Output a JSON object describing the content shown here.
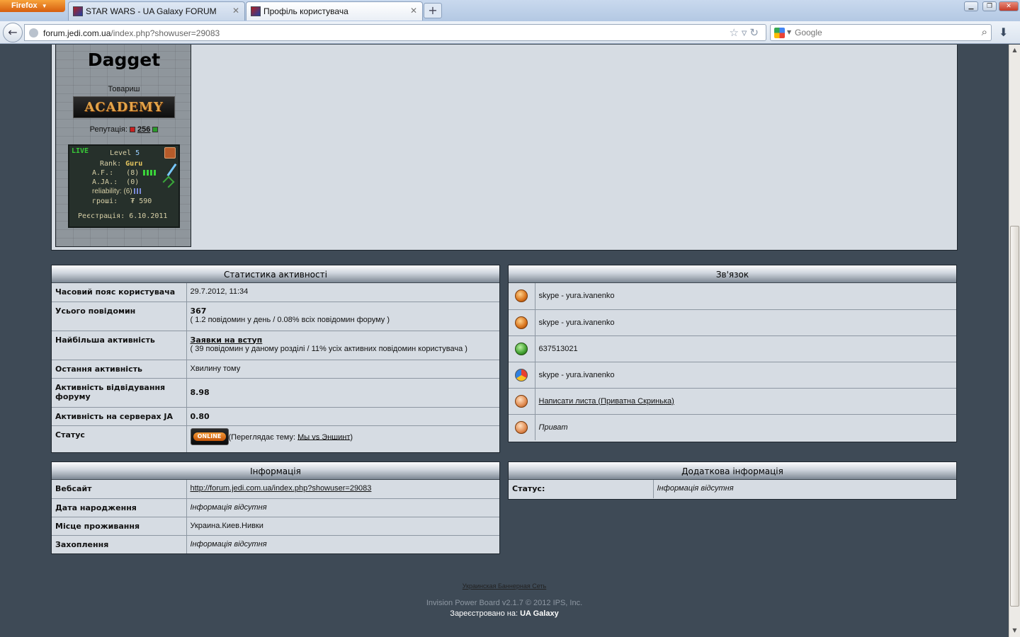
{
  "browser": {
    "app_button": "Firefox",
    "tabs": [
      {
        "label": "STAR WARS - UA Galaxy FORUM"
      },
      {
        "label": "Профіль користувача"
      }
    ],
    "url_domain": "forum.jedi.com.ua",
    "url_path": "/index.php?showuser=29083",
    "search_placeholder": "Google"
  },
  "profile": {
    "name": "Dagget",
    "title": "Товариш",
    "group_badge": "ACADEMY",
    "reputation_label": "Репутація:",
    "reputation_value": "256",
    "stats": {
      "live": "LIVE",
      "level_label": "Level",
      "level_value": "5",
      "rank_label": "Rank:",
      "rank_value": "Guru",
      "af_label": "A.F.:",
      "af_value": "(8)",
      "aja_label": "A.JA.:",
      "aja_value": "(0)",
      "reliability_label": "reliability:",
      "reliability_value": "(6)",
      "money_label": "гроші:",
      "money_value": "590",
      "registration": "Реєстрація: 6.10.2011"
    }
  },
  "activity": {
    "title": "Статистика активності",
    "timezone_label": "Часовий пояс користувача",
    "timezone_value": "29.7.2012, 11:34",
    "posts_label": "Усього повідомин",
    "posts_value": "367",
    "posts_detail": "( 1.2 повідомин у день / 0.08% всіх повідомин форуму )",
    "most_active_label": "Найбільша активність",
    "most_active_forum": "Заявки на вступ",
    "most_active_detail": "( 39 повідомин у даному розділі / 11% усіх активних повідомин користувача )",
    "last_active_label": "Остання активність",
    "last_active_value": "Хвилину тому",
    "visit_label": "Активність відвідування форуму",
    "visit_value": "8.98",
    "ja_label": "Активність на серверах JA",
    "ja_value": "0.80",
    "status_label": "Статус",
    "status_badge": "ONLINE",
    "status_prefix": "(Переглядає тему: ",
    "status_topic": "Мы vs Эншинт",
    "status_suffix": ")"
  },
  "contact": {
    "title": "Зв'язок",
    "rows": [
      {
        "icon": "aim-icon",
        "value": "skype - yura.ivanenko"
      },
      {
        "icon": "msn-icon",
        "value": "skype - yura.ivanenko"
      },
      {
        "icon": "icq-icon",
        "value": "637513021"
      },
      {
        "icon": "gtalk-icon",
        "value": "skype - yura.ivanenko"
      },
      {
        "icon": "mail-icon",
        "value": "Написати листа (Приватна Скринька)"
      },
      {
        "icon": "pm-icon",
        "value": "Приват"
      }
    ]
  },
  "info": {
    "title": "Інформація",
    "website_label": "Вебсайт",
    "website_value": "http://forum.jedi.com.ua/index.php?showuser=29083",
    "birthday_label": "Дата народження",
    "birthday_value": "Інформація відсутня",
    "location_label": "Місце проживання",
    "location_value": "Украина.Киев.Нивки",
    "hobby_label": "Захоплення",
    "hobby_value": "Інформація відсутня"
  },
  "extra": {
    "title": "Додаткова інформація",
    "status_label": "Статус:",
    "status_value": "Інформація відсутня"
  },
  "footer": {
    "banner_link": "Украинская Баннерная Сеть",
    "powered": "Invision Power Board v2.1.7 © 2012  IPS, Inc.",
    "registered_prefix": "Зареєстровано на: ",
    "registered_site": "UA Galaxy"
  }
}
